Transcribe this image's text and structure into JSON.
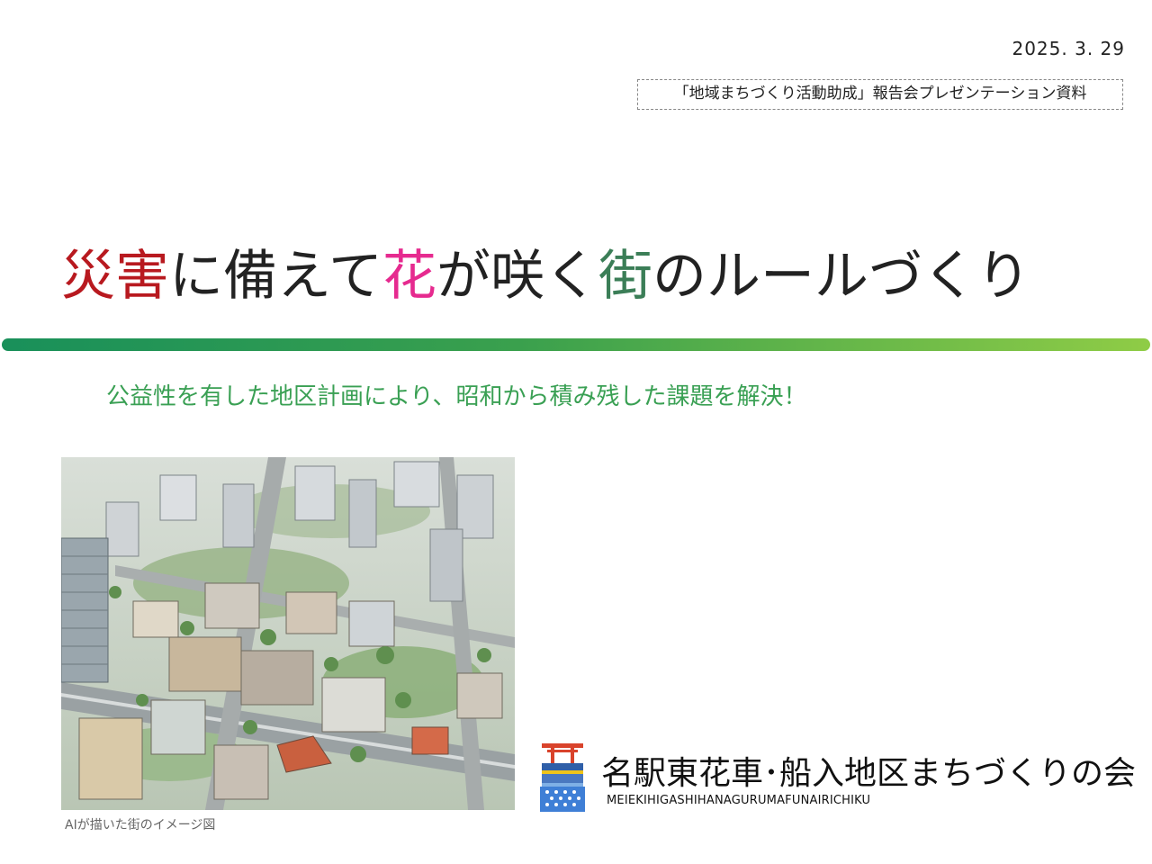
{
  "header": {
    "date": "2025. 3. 29",
    "subtitle": "「地域まちづくり活動助成」報告会プレゼンテーション資料"
  },
  "title": {
    "part1": "災害",
    "part2": "に備えて",
    "part3": "花",
    "part4": "が咲く",
    "part5": "街",
    "part6": "のルールづくり"
  },
  "colors": {
    "disaster": "#b8191f",
    "flower": "#e62a8f",
    "town": "#3b7e57",
    "tagline": "#3aa054",
    "rule_start": "#19905a",
    "rule_end": "#8fcc46"
  },
  "tagline": "公益性を有した地区計画により、昭和から積み残した課題を解決！",
  "image": {
    "caption": "AIが描いた街のイメージ図"
  },
  "organization": {
    "name": "名駅東花車･船入地区まちづくりの会",
    "romanized": "MEIEKIHIGASHIHANAGURUMAFUNAIRICHIKU",
    "logo_icon": "torii-lantern-logo-icon"
  }
}
